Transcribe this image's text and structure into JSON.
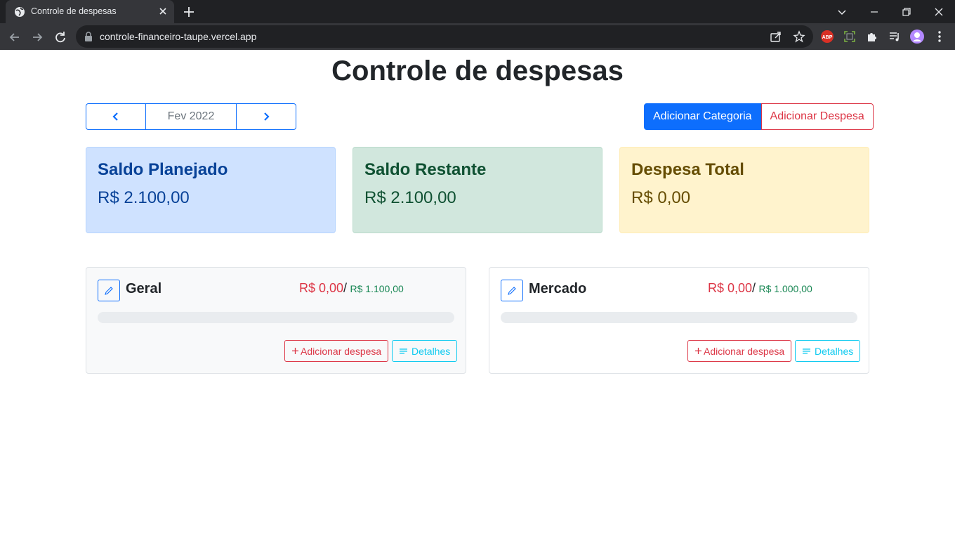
{
  "browser": {
    "tab_title": "Controle de despesas",
    "url": "controle-financeiro-taupe.vercel.app"
  },
  "page": {
    "title": "Controle de despesas",
    "month_label": "Fev 2022",
    "add_category_label": "Adicionar Categoria",
    "add_expense_label": "Adicionar Despesa"
  },
  "summary": {
    "planned": {
      "title": "Saldo Planejado",
      "value": "R$ 2.100,00"
    },
    "remaining": {
      "title": "Saldo Restante",
      "value": "R$ 2.100,00"
    },
    "total": {
      "title": "Despesa Total",
      "value": "R$ 0,00"
    }
  },
  "categories": [
    {
      "name": "Geral",
      "spent": "R$ 0,00",
      "separator": "/",
      "limit": "R$ 1.100,00",
      "progress": 0,
      "add_label": "Adicionar despesa",
      "details_label": "Detalhes"
    },
    {
      "name": "Mercado",
      "spent": "R$ 0,00",
      "separator": "/",
      "limit": "R$ 1.000,00",
      "progress": 0,
      "add_label": "Adicionar despesa",
      "details_label": "Detalhes"
    }
  ],
  "colors": {
    "primary": "#0d6efd",
    "danger": "#dc3545",
    "success": "#198754",
    "info": "#0dcaf0"
  }
}
